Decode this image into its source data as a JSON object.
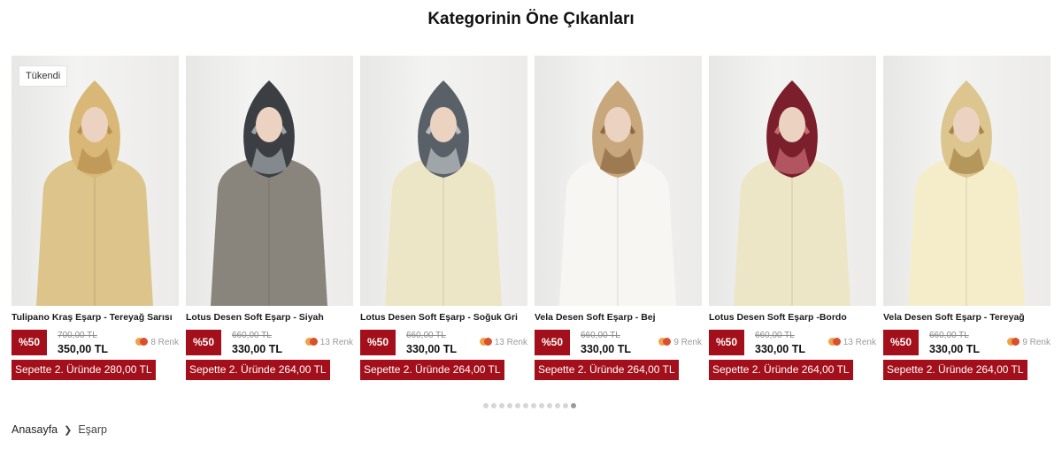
{
  "section": {
    "title": "Kategorinin Öne Çıkanları"
  },
  "products": [
    {
      "name": "Tulipano Kraş Eşarp - Tereyağ Sarısı",
      "badge": "Tükendi",
      "discount": "%50",
      "old_price": "700,00 TL",
      "price": "350,00 TL",
      "colors_count": "8 Renk",
      "basket_offer": "Sepette 2. Üründe 280,00 TL",
      "scarf_color": "#d9b777",
      "scarf_accent": "#b89050",
      "outfit_color": "#dcc48a"
    },
    {
      "name": "Lotus Desen Soft Eşarp - Siyah",
      "discount": "%50",
      "old_price": "660,00 TL",
      "price": "330,00 TL",
      "colors_count": "13 Renk",
      "basket_offer": "Sepette 2. Üründe 264,00 TL",
      "scarf_color": "#3b3f44",
      "scarf_accent": "#9ea3a6",
      "outfit_color": "#8a857c"
    },
    {
      "name": "Lotus Desen Soft Eşarp - Soğuk Gri",
      "discount": "%50",
      "old_price": "660,00 TL",
      "price": "330,00 TL",
      "colors_count": "13 Renk",
      "basket_offer": "Sepette 2. Üründe 264,00 TL",
      "scarf_color": "#5a6068",
      "scarf_accent": "#b8bcc0",
      "outfit_color": "#ede6c6"
    },
    {
      "name": "Vela Desen Soft Eşarp - Bej",
      "discount": "%50",
      "old_price": "660,00 TL",
      "price": "330,00 TL",
      "colors_count": "9 Renk",
      "basket_offer": "Sepette 2. Üründe 264,00 TL",
      "scarf_color": "#c9a77c",
      "scarf_accent": "#8f6b45",
      "outfit_color": "#f7f6f2"
    },
    {
      "name": "Lotus Desen Soft Eşarp -Bordo",
      "discount": "%50",
      "old_price": "660,00 TL",
      "price": "330,00 TL",
      "colors_count": "13 Renk",
      "basket_offer": "Sepette 2. Üründe 264,00 TL",
      "scarf_color": "#7a1f2b",
      "scarf_accent": "#c46a74",
      "outfit_color": "#ede6c6"
    },
    {
      "name": "Vela Desen Soft Eşarp - Tereyağ",
      "discount": "%50",
      "old_price": "660,00 TL",
      "price": "330,00 TL",
      "colors_count": "9 Renk",
      "basket_offer": "Sepette 2. Üründe 264,00 TL",
      "scarf_color": "#dcc58e",
      "scarf_accent": "#a8874a",
      "outfit_color": "#f5edc9"
    }
  ],
  "pagination": {
    "total": 12,
    "active": 11
  },
  "breadcrumb": {
    "home": "Anasayfa",
    "separator": "chevron-right-icon",
    "current": "Eşarp"
  }
}
